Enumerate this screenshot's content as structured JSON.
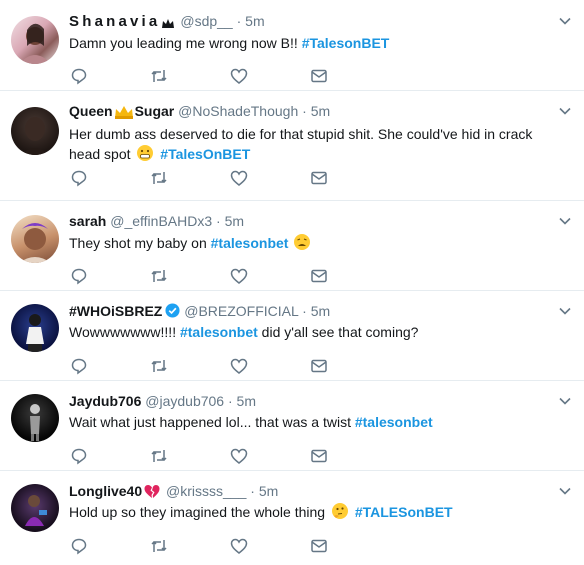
{
  "tweets": [
    {
      "name": "Shanavia",
      "name_emoji": "crown-icon",
      "handle": "@sdp__",
      "time": "5m",
      "text_parts": [
        {
          "t": "Damn you leading me wrong now B!! "
        },
        {
          "t": "#TalesonBET",
          "hashtag": true
        }
      ]
    },
    {
      "name_pre": "Queen",
      "name_emoji": "crown-icon",
      "name_post": "Sugar",
      "handle": "@NoShadeThough",
      "time": "5m",
      "text_parts": [
        {
          "t": "Her dumb ass deserved to die for that stupid shit. She could've hid in crack head spot "
        },
        {
          "emoji": "grimace-emoji"
        },
        {
          "t": " #TalesOnBET",
          "hashtag": true
        }
      ]
    },
    {
      "name": "sarah",
      "handle": "@_effinBAHDx3",
      "time": "5m",
      "text_parts": [
        {
          "t": "They shot my baby on "
        },
        {
          "t": "#talesonbet",
          "hashtag": true
        },
        {
          "emoji": "weary-face-emoji"
        }
      ]
    },
    {
      "name": "#WHOiSBREZ",
      "verified": true,
      "handle": "@BREZOFFICIAL",
      "time": "5m",
      "text_parts": [
        {
          "t": "Wowwwwwww!!!! "
        },
        {
          "t": "#talesonbet",
          "hashtag": true
        },
        {
          "t": " did y'all see that coming?"
        }
      ]
    },
    {
      "name": "Jaydub706",
      "handle": "@jaydub706",
      "time": "5m",
      "text_parts": [
        {
          "t": "Wait what just happened lol... that was a twist "
        },
        {
          "t": "#talesonbet",
          "hashtag": true
        }
      ]
    },
    {
      "name": "Longlive40",
      "name_emoji": "broken-heart-icon",
      "handle": "@krissss___",
      "time": "5m",
      "text_parts": [
        {
          "t": "Hold up so they imagined the whole thing "
        },
        {
          "emoji": "thinking-face-emoji"
        },
        {
          "t": " #TALESonBET",
          "hashtag": true
        }
      ]
    }
  ],
  "separator": "·",
  "colors": {
    "hashtag": "#1b95e0",
    "muted": "#657786",
    "text": "#14171a",
    "border": "#e6ecf0"
  }
}
